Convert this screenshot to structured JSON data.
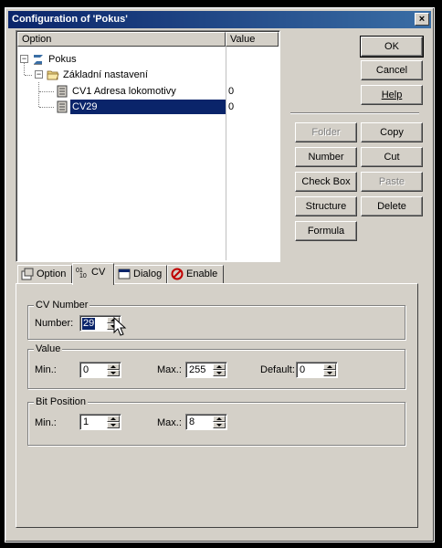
{
  "window": {
    "title": "Configuration of 'Pokus'",
    "close_glyph": "×"
  },
  "tree": {
    "columns": [
      "Option",
      "Value"
    ],
    "rows": [
      {
        "label": "Pokus",
        "value": "",
        "icon": "pokus-root-icon",
        "expander": "−"
      },
      {
        "label": "Základní nastavení",
        "value": "",
        "icon": "folder-icon",
        "expander": "−"
      },
      {
        "label": "CV1 Adresa lokomotivy",
        "value": "0",
        "icon": "cv-item-icon"
      },
      {
        "label": "CV29",
        "value": "0",
        "icon": "cv-item-icon",
        "selected": true
      }
    ]
  },
  "buttons": {
    "ok": "OK",
    "cancel": "Cancel",
    "help": "Help",
    "folder": "Folder",
    "copy": "Copy",
    "number": "Number",
    "cut": "Cut",
    "checkbox": "Check Box",
    "paste": "Paste",
    "structure": "Structure",
    "delete": "Delete",
    "formula": "Formula"
  },
  "tabs": [
    {
      "label": "Option",
      "icon": "option-tab-icon"
    },
    {
      "label": "CV",
      "icon": "cv-tab-icon",
      "active": true
    },
    {
      "label": "Dialog",
      "icon": "dialog-tab-icon"
    },
    {
      "label": "Enable",
      "icon": "enable-tab-icon"
    }
  ],
  "cv_number": {
    "group": "CV Number",
    "label": "Number:",
    "value": "29"
  },
  "value_group": {
    "group": "Value",
    "min_label": "Min.:",
    "min": "0",
    "max_label": "Max.:",
    "max": "255",
    "default_label": "Default:",
    "default": "0"
  },
  "bit_position": {
    "group": "Bit Position",
    "min_label": "Min.:",
    "min": "1",
    "max_label": "Max.:",
    "max": "8"
  },
  "colors": {
    "title_start": "#0a246a",
    "title_end": "#3a6ea5",
    "face": "#d4d0c8",
    "selection": "#0a246a"
  }
}
